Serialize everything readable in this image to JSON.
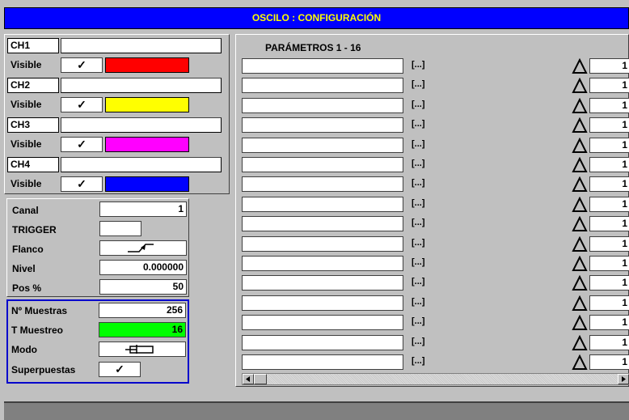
{
  "window": {
    "title": "OSCILO : CONFIGURACIÓN"
  },
  "channels": [
    {
      "name": "CH1",
      "visible_label": "Visible",
      "check": "✓",
      "color": "#ff0000"
    },
    {
      "name": "CH2",
      "visible_label": "Visible",
      "check": "✓",
      "color": "#ffff00"
    },
    {
      "name": "CH3",
      "visible_label": "Visible",
      "check": "✓",
      "color": "#ff00ff"
    },
    {
      "name": "CH4",
      "visible_label": "Visible",
      "check": "✓",
      "color": "#0000ff"
    }
  ],
  "trigger": {
    "canal_label": "Canal",
    "canal_value": "1",
    "trigger_label": "TRIGGER",
    "trigger_value": "",
    "flanco_label": "Flanco",
    "flanco_icon": "rising-edge-icon",
    "nivel_label": "Nivel",
    "nivel_value": "0.000000",
    "pos_label": "Pos %",
    "pos_value": "50"
  },
  "sampling": {
    "muestras_label": "Nº Muestras",
    "muestras_value": "256",
    "tmuestreo_label": "T Muestreo",
    "tmuestreo_value": "16",
    "tmuestreo_color": "#00ff00",
    "modo_label": "Modo",
    "modo_icon": "mode-icon",
    "superpuestas_label": "Superpuestas",
    "superpuestas_check": "✓"
  },
  "params": {
    "title": "PARÁMETROS 1 - 16",
    "rows": [
      {
        "dots": "[...]",
        "value": "1"
      },
      {
        "dots": "[...]",
        "value": "1"
      },
      {
        "dots": "[...]",
        "value": "1"
      },
      {
        "dots": "[...]",
        "value": "1"
      },
      {
        "dots": "[...]",
        "value": "1"
      },
      {
        "dots": "[...]",
        "value": "1"
      },
      {
        "dots": "[...]",
        "value": "1"
      },
      {
        "dots": "[...]",
        "value": "1"
      },
      {
        "dots": "[...]",
        "value": "1"
      },
      {
        "dots": "[...]",
        "value": "1"
      },
      {
        "dots": "[...]",
        "value": "1"
      },
      {
        "dots": "[...]",
        "value": "1"
      },
      {
        "dots": "[...]",
        "value": "1"
      },
      {
        "dots": "[...]",
        "value": "1"
      },
      {
        "dots": "[...]",
        "value": "1"
      },
      {
        "dots": "[...]",
        "value": "1"
      }
    ]
  }
}
